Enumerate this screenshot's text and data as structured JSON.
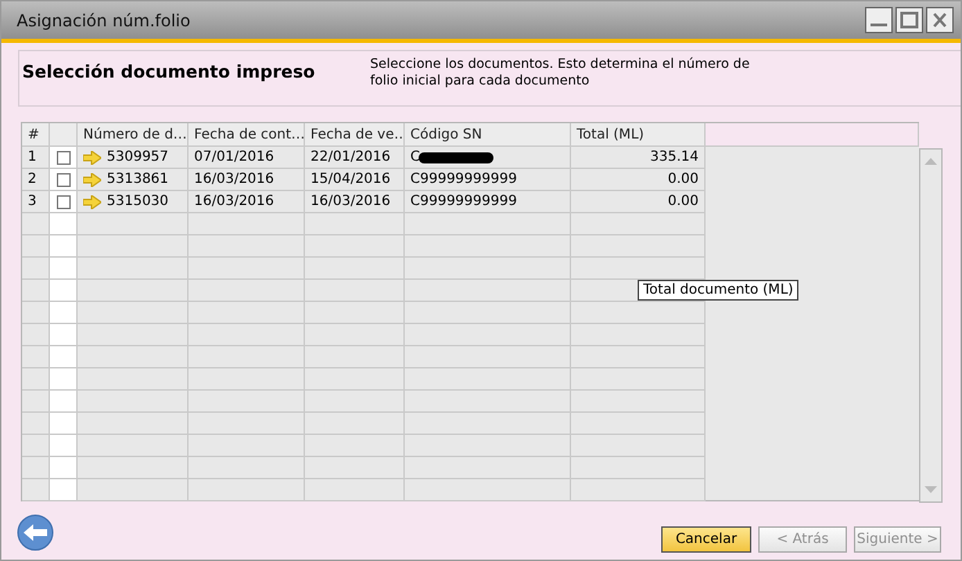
{
  "window": {
    "title": "Asignación núm.folio"
  },
  "header": {
    "title": "Selección documento impreso",
    "description": "Seleccione los documentos. Esto determina el número de folio inicial para cada documento"
  },
  "table": {
    "columns": [
      "#",
      "Número de d…",
      "Fecha de cont…",
      "Fecha de ve…",
      "Código SN",
      "Total (ML)"
    ],
    "rows": [
      {
        "index": "1",
        "checked": false,
        "number": "5309957",
        "posting_date": "07/01/2016",
        "due_date": "22/01/2016",
        "code": "C",
        "redacted": true,
        "total": "335.14"
      },
      {
        "index": "2",
        "checked": false,
        "number": "5313861",
        "posting_date": "16/03/2016",
        "due_date": "15/04/2016",
        "code": "C99999999999",
        "redacted": false,
        "total": "0.00"
      },
      {
        "index": "3",
        "checked": false,
        "number": "5315030",
        "posting_date": "16/03/2016",
        "due_date": "16/03/2016",
        "code": "C99999999999",
        "redacted": false,
        "total": "0.00"
      }
    ]
  },
  "tooltip": "Total documento (ML)",
  "buttons": [
    {
      "label": "Cancelar",
      "disabled": false,
      "default": true
    },
    {
      "label": "< Atrás",
      "disabled": true,
      "default": false
    },
    {
      "label": "Siguiente >",
      "disabled": true,
      "default": false
    }
  ]
}
